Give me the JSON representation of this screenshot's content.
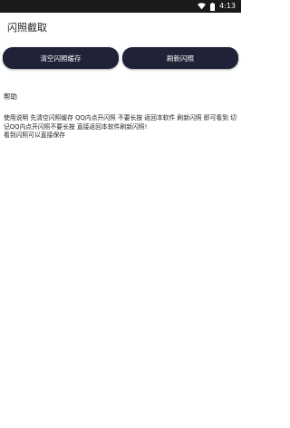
{
  "status_bar": {
    "time": "4:13",
    "icons": [
      "wifi-icon",
      "battery-icon"
    ]
  },
  "app_bar": {
    "title": "闪照截取"
  },
  "buttons": {
    "clear_label": "清空闪照缓存",
    "refresh_label": "刷新闪照"
  },
  "help": {
    "title": "帮助",
    "text_line1": "使用说明 先清空闪照缓存 QQ内点开闪照 不要长按 返回本软件 刷新闪照 即可看到 切记QQ内点开闪照不要长按 直接返回本软件刷新闪照!",
    "text_line2": "看到闪照可以直接保存"
  },
  "colors": {
    "status_bar_bg": "#1a1a1a",
    "button_bg": "#202338",
    "button_text": "#ffffff",
    "background": "#ffffff"
  }
}
